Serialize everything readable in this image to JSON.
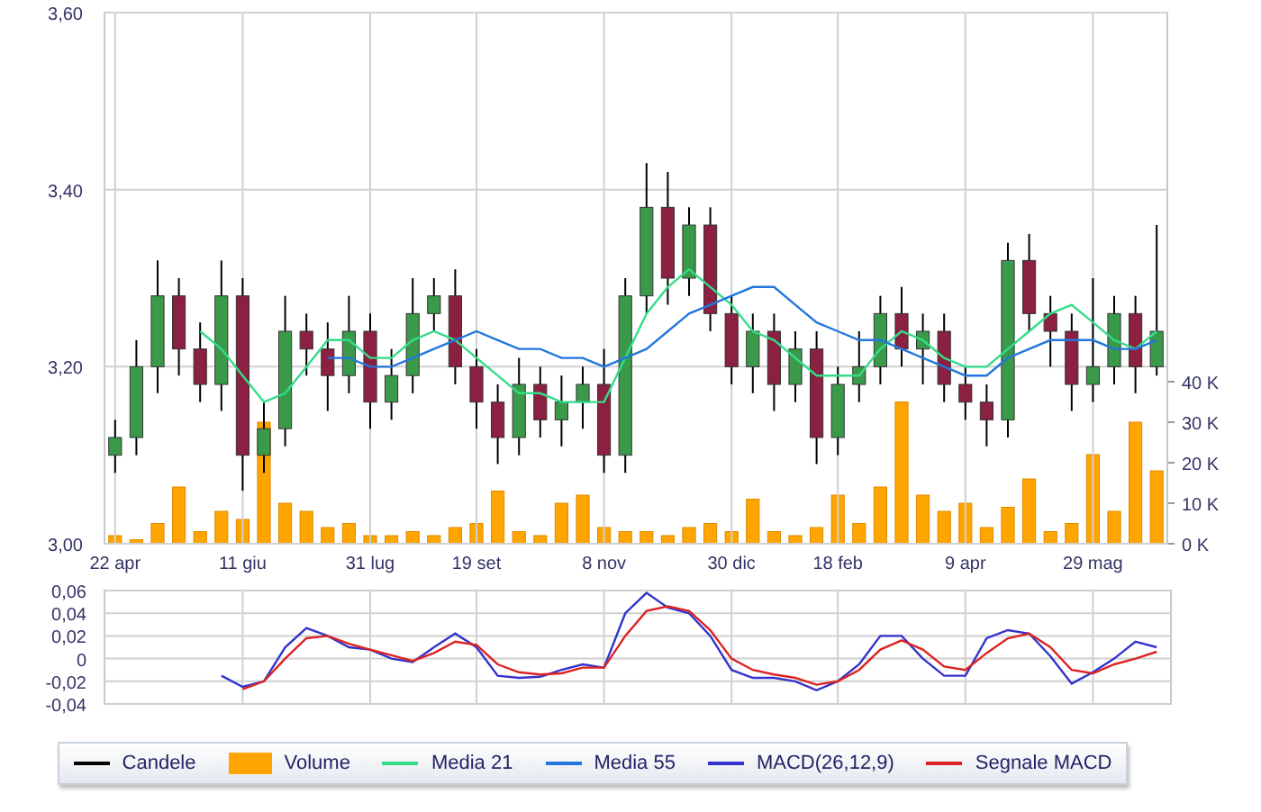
{
  "price_chart": {
    "candles": {
      "name": "Candele",
      "color": "#000000"
    },
    "chart_data": {
      "type": "candlestick",
      "grid": true,
      "ohlc": [
        [
          3.1,
          3.14,
          3.08,
          3.12
        ],
        [
          3.12,
          3.23,
          3.1,
          3.2
        ],
        [
          3.2,
          3.32,
          3.17,
          3.28
        ],
        [
          3.28,
          3.3,
          3.19,
          3.22
        ],
        [
          3.22,
          3.25,
          3.16,
          3.18
        ],
        [
          3.18,
          3.32,
          3.15,
          3.28
        ],
        [
          3.28,
          3.3,
          3.06,
          3.1
        ],
        [
          3.1,
          3.16,
          3.08,
          3.13
        ],
        [
          3.13,
          3.28,
          3.11,
          3.24
        ],
        [
          3.24,
          3.26,
          3.19,
          3.22
        ],
        [
          3.22,
          3.25,
          3.15,
          3.19
        ],
        [
          3.19,
          3.28,
          3.17,
          3.24
        ],
        [
          3.24,
          3.26,
          3.13,
          3.16
        ],
        [
          3.16,
          3.22,
          3.14,
          3.19
        ],
        [
          3.19,
          3.3,
          3.17,
          3.26
        ],
        [
          3.26,
          3.3,
          3.24,
          3.28
        ],
        [
          3.28,
          3.31,
          3.18,
          3.2
        ],
        [
          3.2,
          3.22,
          3.13,
          3.16
        ],
        [
          3.16,
          3.18,
          3.09,
          3.12
        ],
        [
          3.12,
          3.21,
          3.1,
          3.18
        ],
        [
          3.18,
          3.2,
          3.12,
          3.14
        ],
        [
          3.14,
          3.19,
          3.11,
          3.16
        ],
        [
          3.16,
          3.2,
          3.13,
          3.18
        ],
        [
          3.18,
          3.22,
          3.08,
          3.1
        ],
        [
          3.1,
          3.3,
          3.08,
          3.28
        ],
        [
          3.28,
          3.43,
          3.26,
          3.38
        ],
        [
          3.38,
          3.42,
          3.27,
          3.3
        ],
        [
          3.3,
          3.38,
          3.28,
          3.36
        ],
        [
          3.36,
          3.38,
          3.24,
          3.26
        ],
        [
          3.26,
          3.28,
          3.18,
          3.2
        ],
        [
          3.2,
          3.26,
          3.17,
          3.24
        ],
        [
          3.24,
          3.26,
          3.15,
          3.18
        ],
        [
          3.18,
          3.24,
          3.16,
          3.22
        ],
        [
          3.22,
          3.24,
          3.09,
          3.12
        ],
        [
          3.12,
          3.2,
          3.1,
          3.18
        ],
        [
          3.18,
          3.24,
          3.16,
          3.2
        ],
        [
          3.2,
          3.28,
          3.18,
          3.26
        ],
        [
          3.26,
          3.29,
          3.2,
          3.22
        ],
        [
          3.22,
          3.26,
          3.18,
          3.24
        ],
        [
          3.24,
          3.26,
          3.16,
          3.18
        ],
        [
          3.18,
          3.2,
          3.14,
          3.16
        ],
        [
          3.16,
          3.18,
          3.11,
          3.14
        ],
        [
          3.14,
          3.34,
          3.12,
          3.32
        ],
        [
          3.32,
          3.35,
          3.24,
          3.26
        ],
        [
          3.26,
          3.28,
          3.2,
          3.24
        ],
        [
          3.24,
          3.26,
          3.15,
          3.18
        ],
        [
          3.18,
          3.3,
          3.16,
          3.2
        ],
        [
          3.2,
          3.28,
          3.18,
          3.26
        ],
        [
          3.26,
          3.28,
          3.17,
          3.2
        ],
        [
          3.2,
          3.36,
          3.19,
          3.24
        ]
      ],
      "categories": [
        "22 apr",
        null,
        null,
        null,
        null,
        null,
        "11 giu",
        null,
        null,
        null,
        null,
        null,
        "31 lug",
        null,
        null,
        null,
        null,
        "19 set",
        null,
        null,
        null,
        null,
        null,
        "8 nov",
        null,
        null,
        null,
        null,
        null,
        "30 dic",
        null,
        null,
        null,
        null,
        "18 feb",
        null,
        null,
        null,
        null,
        null,
        "9 apr",
        null,
        null,
        null,
        null,
        null,
        "29 mag",
        null,
        null,
        null
      ],
      "ylim": [
        3.0,
        3.6
      ],
      "yticks": [
        {
          "value": 3.0,
          "label": "3,00"
        },
        {
          "value": 3.2,
          "label": "3,20"
        },
        {
          "value": 3.4,
          "label": "3,40"
        },
        {
          "value": 3.6,
          "label": "3,60"
        }
      ],
      "series": [
        {
          "name": "Media 21",
          "type": "line",
          "color": "#33dd88",
          "values": [
            null,
            null,
            null,
            null,
            3.24,
            3.22,
            3.19,
            3.16,
            3.17,
            3.2,
            3.23,
            3.23,
            3.21,
            3.21,
            3.23,
            3.24,
            3.23,
            3.21,
            3.19,
            3.17,
            3.17,
            3.16,
            3.16,
            3.16,
            3.21,
            3.26,
            3.29,
            3.31,
            3.29,
            3.27,
            3.24,
            3.23,
            3.21,
            3.19,
            3.19,
            3.19,
            3.22,
            3.24,
            3.23,
            3.21,
            3.2,
            3.2,
            3.22,
            3.24,
            3.26,
            3.27,
            3.25,
            3.23,
            3.22,
            3.24
          ]
        },
        {
          "name": "Media 55",
          "type": "line",
          "color": "#2277dd",
          "values": [
            null,
            null,
            null,
            null,
            null,
            null,
            null,
            null,
            null,
            null,
            3.21,
            3.21,
            3.2,
            3.2,
            3.21,
            3.22,
            3.23,
            3.24,
            3.23,
            3.22,
            3.22,
            3.21,
            3.21,
            3.2,
            3.21,
            3.22,
            3.24,
            3.26,
            3.27,
            3.28,
            3.29,
            3.29,
            3.27,
            3.25,
            3.24,
            3.23,
            3.23,
            3.22,
            3.21,
            3.2,
            3.19,
            3.19,
            3.21,
            3.22,
            3.23,
            3.23,
            3.23,
            3.22,
            3.22,
            3.23
          ]
        }
      ]
    }
  },
  "volume_chart": {
    "chart_data": {
      "type": "bar",
      "categories": [
        null,
        null,
        null,
        null,
        null,
        null,
        null,
        null,
        null,
        null,
        null,
        null,
        null,
        null,
        null,
        null,
        null,
        null,
        null,
        null,
        null,
        null,
        null,
        null,
        null,
        null,
        null,
        null,
        null,
        null,
        null,
        null,
        null,
        null,
        null,
        null,
        null,
        null,
        null,
        null,
        null,
        null,
        null,
        null,
        null,
        null,
        null,
        null,
        null,
        null
      ],
      "ylim": [
        0,
        40
      ],
      "yticks": [
        {
          "value": 0,
          "label": "0 K"
        },
        {
          "value": 10,
          "label": "10 K"
        },
        {
          "value": 20,
          "label": "20 K"
        },
        {
          "value": 30,
          "label": "30 K"
        },
        {
          "value": 40,
          "label": "40 K"
        }
      ],
      "series": [
        {
          "name": "Volume",
          "color": "#ffa500",
          "values": [
            2,
            1,
            5,
            14,
            3,
            8,
            6,
            30,
            10,
            8,
            4,
            5,
            2,
            2,
            3,
            2,
            4,
            5,
            13,
            3,
            2,
            10,
            12,
            4,
            3,
            3,
            2,
            4,
            5,
            3,
            11,
            3,
            2,
            4,
            12,
            5,
            14,
            35,
            12,
            8,
            10,
            4,
            9,
            16,
            3,
            5,
            22,
            8,
            30,
            18
          ]
        }
      ]
    }
  },
  "macd_chart": {
    "chart_data": {
      "type": "line",
      "grid": true,
      "categories": [
        null,
        null,
        null,
        null,
        null,
        null,
        null,
        null,
        null,
        null,
        null,
        null,
        null,
        null,
        null,
        null,
        null,
        null,
        null,
        null,
        null,
        null,
        null,
        null,
        null,
        null,
        null,
        null,
        null,
        null,
        null,
        null,
        null,
        null,
        null,
        null,
        null,
        null,
        null,
        null,
        null,
        null,
        null,
        null,
        null,
        null,
        null,
        null,
        null,
        null
      ],
      "ylim": [
        -0.04,
        0.06
      ],
      "yticks": [
        {
          "value": -0.04,
          "label": "-0,04"
        },
        {
          "value": -0.02,
          "label": "-0,02"
        },
        {
          "value": 0,
          "label": "0"
        },
        {
          "value": 0.02,
          "label": "0,02"
        },
        {
          "value": 0.04,
          "label": "0,04"
        },
        {
          "value": 0.06,
          "label": "0,06"
        }
      ],
      "series": [
        {
          "name": "MACD(26,12,9)",
          "color": "#3333cc",
          "values": [
            null,
            null,
            null,
            null,
            null,
            -0.015,
            -0.025,
            -0.02,
            0.01,
            0.027,
            0.02,
            0.01,
            0.008,
            0.0,
            -0.003,
            0.01,
            0.022,
            0.01,
            -0.015,
            -0.017,
            -0.016,
            -0.01,
            -0.005,
            -0.008,
            0.04,
            0.058,
            0.045,
            0.04,
            0.02,
            -0.01,
            -0.017,
            -0.017,
            -0.02,
            -0.028,
            -0.02,
            -0.005,
            0.02,
            0.02,
            0.0,
            -0.015,
            -0.015,
            0.018,
            0.025,
            0.022,
            0.002,
            -0.022,
            -0.012,
            0.0,
            0.015,
            0.01
          ]
        },
        {
          "name": "Segnale MACD",
          "color": "#dd2222",
          "values": [
            null,
            null,
            null,
            null,
            null,
            null,
            -0.027,
            -0.02,
            0.0,
            0.018,
            0.02,
            0.013,
            0.008,
            0.003,
            -0.002,
            0.005,
            0.015,
            0.012,
            -0.005,
            -0.012,
            -0.014,
            -0.013,
            -0.008,
            -0.008,
            0.02,
            0.042,
            0.046,
            0.042,
            0.025,
            0.0,
            -0.01,
            -0.014,
            -0.017,
            -0.023,
            -0.02,
            -0.01,
            0.008,
            0.016,
            0.008,
            -0.007,
            -0.01,
            0.005,
            0.018,
            0.022,
            0.01,
            -0.01,
            -0.013,
            -0.005,
            0.0,
            0.006
          ]
        }
      ]
    }
  }
}
